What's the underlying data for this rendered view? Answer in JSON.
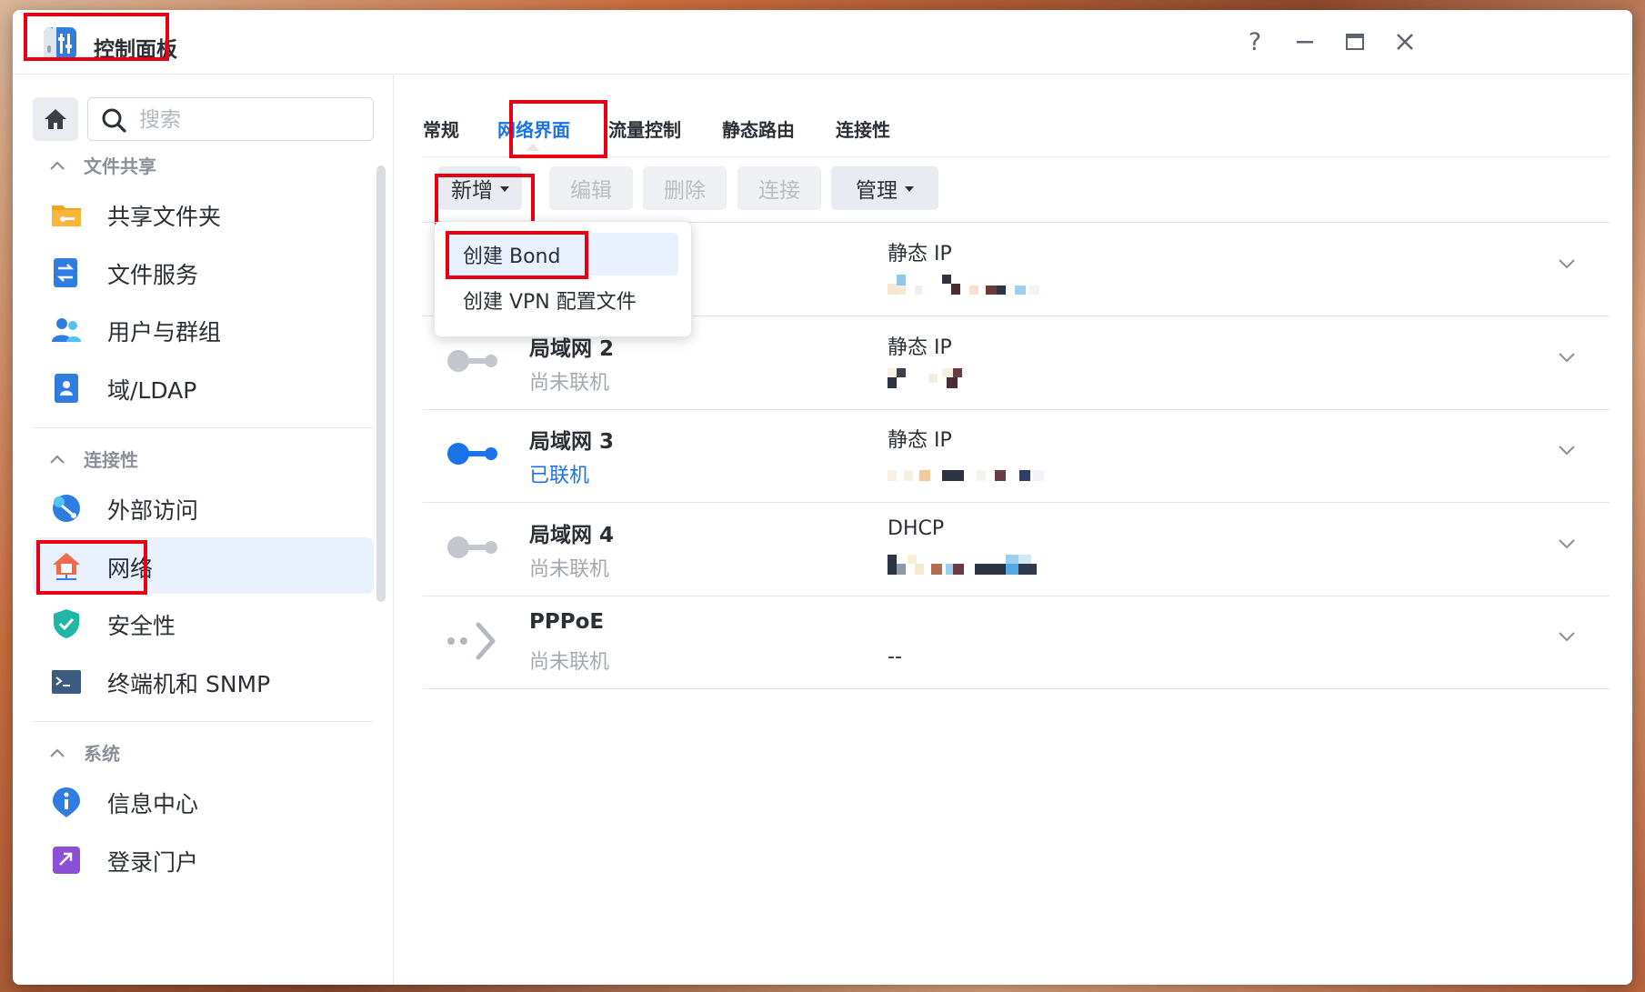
{
  "window": {
    "title": "控制面板",
    "controls": [
      "help",
      "minimize",
      "maximize",
      "close"
    ],
    "help_label": "?"
  },
  "sidebar": {
    "search_placeholder": "搜索",
    "sections": [
      {
        "title": "文件共享",
        "items": [
          "共享文件夹",
          "文件服务",
          "用户与群组",
          "域/LDAP"
        ]
      },
      {
        "title": "连接性",
        "items": [
          "外部访问",
          "网络",
          "安全性",
          "终端机和 SNMP"
        ]
      },
      {
        "title": "系统",
        "items": [
          "信息中心",
          "登录门户"
        ]
      }
    ],
    "active_item": "网络"
  },
  "tabs": [
    "常规",
    "网络界面",
    "流量控制",
    "静态路由",
    "连接性"
  ],
  "active_tab": "网络界面",
  "toolbar": {
    "add": "新增",
    "edit": "编辑",
    "delete": "删除",
    "connect": "连接",
    "manage": "管理"
  },
  "dropdown": {
    "items": [
      "创建 Bond",
      "创建 VPN 配置文件"
    ],
    "hovered": "创建 Bond"
  },
  "interfaces": [
    {
      "name": "",
      "status": "",
      "type": "静态 IP",
      "address": "",
      "connected": false
    },
    {
      "name": "局域网 2",
      "status": "尚未联机",
      "type": "静态 IP",
      "address": "",
      "connected": false
    },
    {
      "name": "局域网 3",
      "status": "已联机",
      "type": "静态 IP",
      "address": "",
      "connected": true
    },
    {
      "name": "局域网 4",
      "status": "尚未联机",
      "type": "DHCP",
      "address": "",
      "connected": false
    },
    {
      "name": "PPPoE",
      "status": "尚未联机",
      "type": "",
      "address": "--",
      "connected": false
    }
  ],
  "colors": {
    "accent": "#1a73e8",
    "highlight_box": "#e60012",
    "active_bg": "#e8f1fd"
  }
}
